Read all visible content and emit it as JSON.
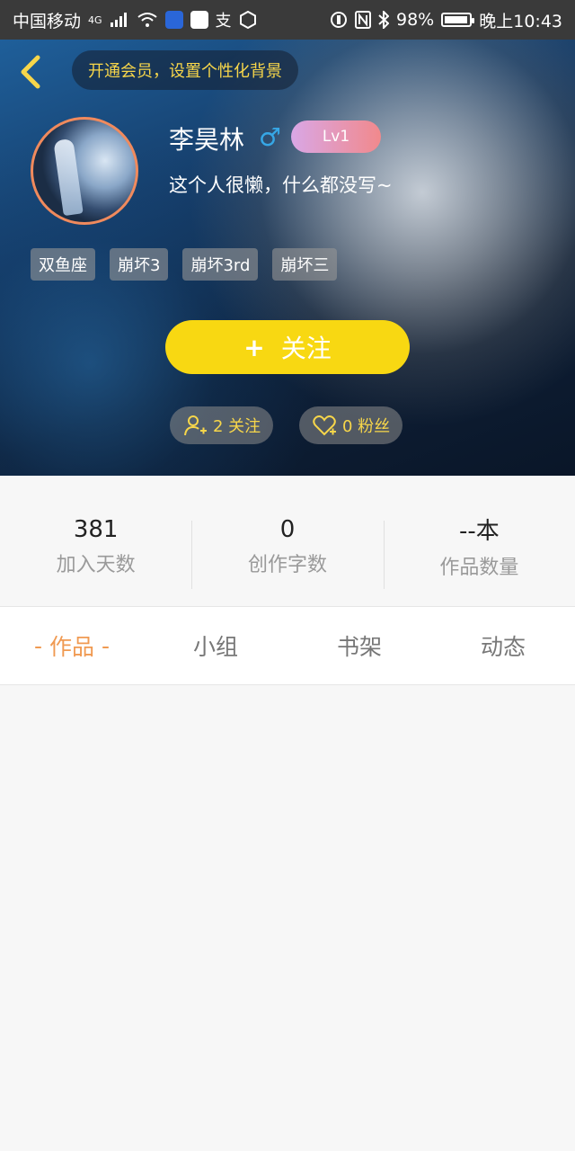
{
  "status_bar": {
    "carrier": "中国移动",
    "network": "4G",
    "battery": "98%",
    "battery_level": 0.98,
    "time": "晚上10:43",
    "icons": [
      "signal-icon",
      "wifi-icon",
      "bulb-notification-icon",
      "mail-notification-icon",
      "alipay-icon",
      "hand-icon",
      "nfc-icon",
      "bluetooth-icon",
      "battery-icon"
    ]
  },
  "header": {
    "promo_text": "开通会员，设置个性化背景",
    "user_name": "李昊林",
    "gender_symbol": "♂",
    "level": "Lv1",
    "bio": "这个人很懒，什么都没写~",
    "tags": [
      "双鱼座",
      "崩坏3",
      "崩坏3rd",
      "崩坏三"
    ],
    "follow_label": "关注",
    "follow_plus": "+",
    "following_count": "2 关注",
    "fans_count": "0 粉丝",
    "colors": {
      "accent": "#f8d812",
      "promo_text": "#f7d64a",
      "level_gradient_start": "#d9a7e6",
      "level_gradient_end": "#f1898c",
      "avatar_border": "#f08a5d"
    }
  },
  "stats": [
    {
      "value": "381",
      "label": "加入天数"
    },
    {
      "value": "0",
      "label": "创作字数"
    },
    {
      "value": "--本",
      "label": "作品数量"
    }
  ],
  "tabs": {
    "active_dash": "-",
    "items": [
      "作品",
      "小组",
      "书架",
      "动态"
    ],
    "active_color": "#f09a52"
  }
}
